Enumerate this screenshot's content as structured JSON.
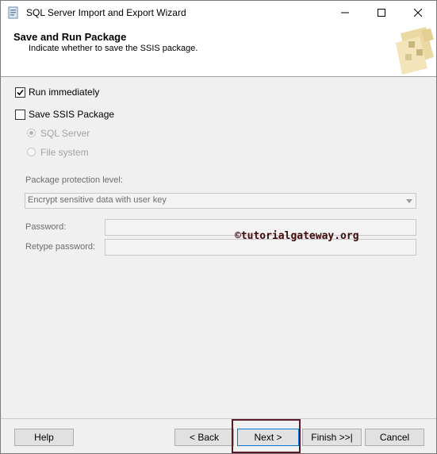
{
  "window": {
    "title": "SQL Server Import and Export Wizard"
  },
  "header": {
    "title": "Save and Run Package",
    "subtitle": "Indicate whether to save the SSIS package."
  },
  "options": {
    "run_immediately": {
      "label": "Run immediately",
      "checked": true
    },
    "save_package": {
      "label": "Save SSIS Package",
      "checked": false
    },
    "sql_server": {
      "label": "SQL Server",
      "selected": true,
      "enabled": false
    },
    "file_system": {
      "label": "File system",
      "selected": false,
      "enabled": false
    }
  },
  "protection": {
    "label": "Package protection level:",
    "selected": "Encrypt sensitive data with user key"
  },
  "password": {
    "label": "Password:",
    "value": ""
  },
  "retype_password": {
    "label": "Retype password:",
    "value": ""
  },
  "watermark": "©tutorialgateway.org",
  "buttons": {
    "help": "Help",
    "back": "< Back",
    "next": "Next >",
    "finish": "Finish >>|",
    "cancel": "Cancel"
  },
  "colors": {
    "highlight": "#5a1a2a",
    "watermark": "#3f0b0b"
  }
}
